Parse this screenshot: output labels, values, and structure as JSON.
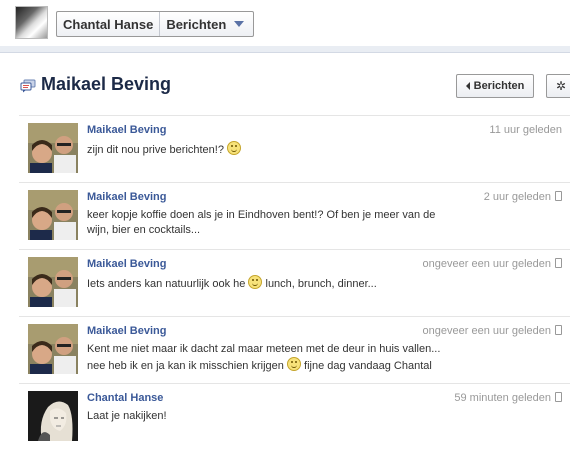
{
  "topbar": {
    "user_name": "Chantal Hanse",
    "section_label": "Berichten"
  },
  "thread": {
    "title": "Maikael Beving",
    "back_label": "Berichten",
    "gear_icon": "gear-icon",
    "title_icon": "messages-icon"
  },
  "colors": {
    "link": "#3b5998",
    "title": "#1c2a47",
    "timestamp": "#999999"
  },
  "messages": [
    {
      "author": "Maikael Beving",
      "time": "11 uur geleden",
      "mobile": false,
      "lines": [
        "zijn dit nou prive berichten!?"
      ],
      "smiley_after": true
    },
    {
      "author": "Maikael Beving",
      "time": "2 uur geleden",
      "mobile": true,
      "lines": [
        "keer kopje koffie doen als je in Eindhoven bent!? Of ben je meer van de",
        "wijn, bier en cocktails..."
      ]
    },
    {
      "author": "Maikael Beving",
      "time": "ongeveer een uur geleden",
      "mobile": true,
      "text_before": "Iets anders kan natuurlijk ook he",
      "text_after": "lunch, brunch, dinner..."
    },
    {
      "author": "Maikael Beving",
      "time": "ongeveer een uur geleden",
      "mobile": true,
      "line1": "Kent me niet maar ik dacht zal maar meteen met de deur in huis vallen...",
      "line2_before": "nee heb ik en ja kan ik misschien krijgen",
      "line2_after": "fijne dag vandaag Chantal"
    },
    {
      "author": "Chantal Hanse",
      "time": "59 minuten geleden",
      "mobile": true,
      "lines": [
        "Laat je nakijken!"
      ]
    }
  ]
}
